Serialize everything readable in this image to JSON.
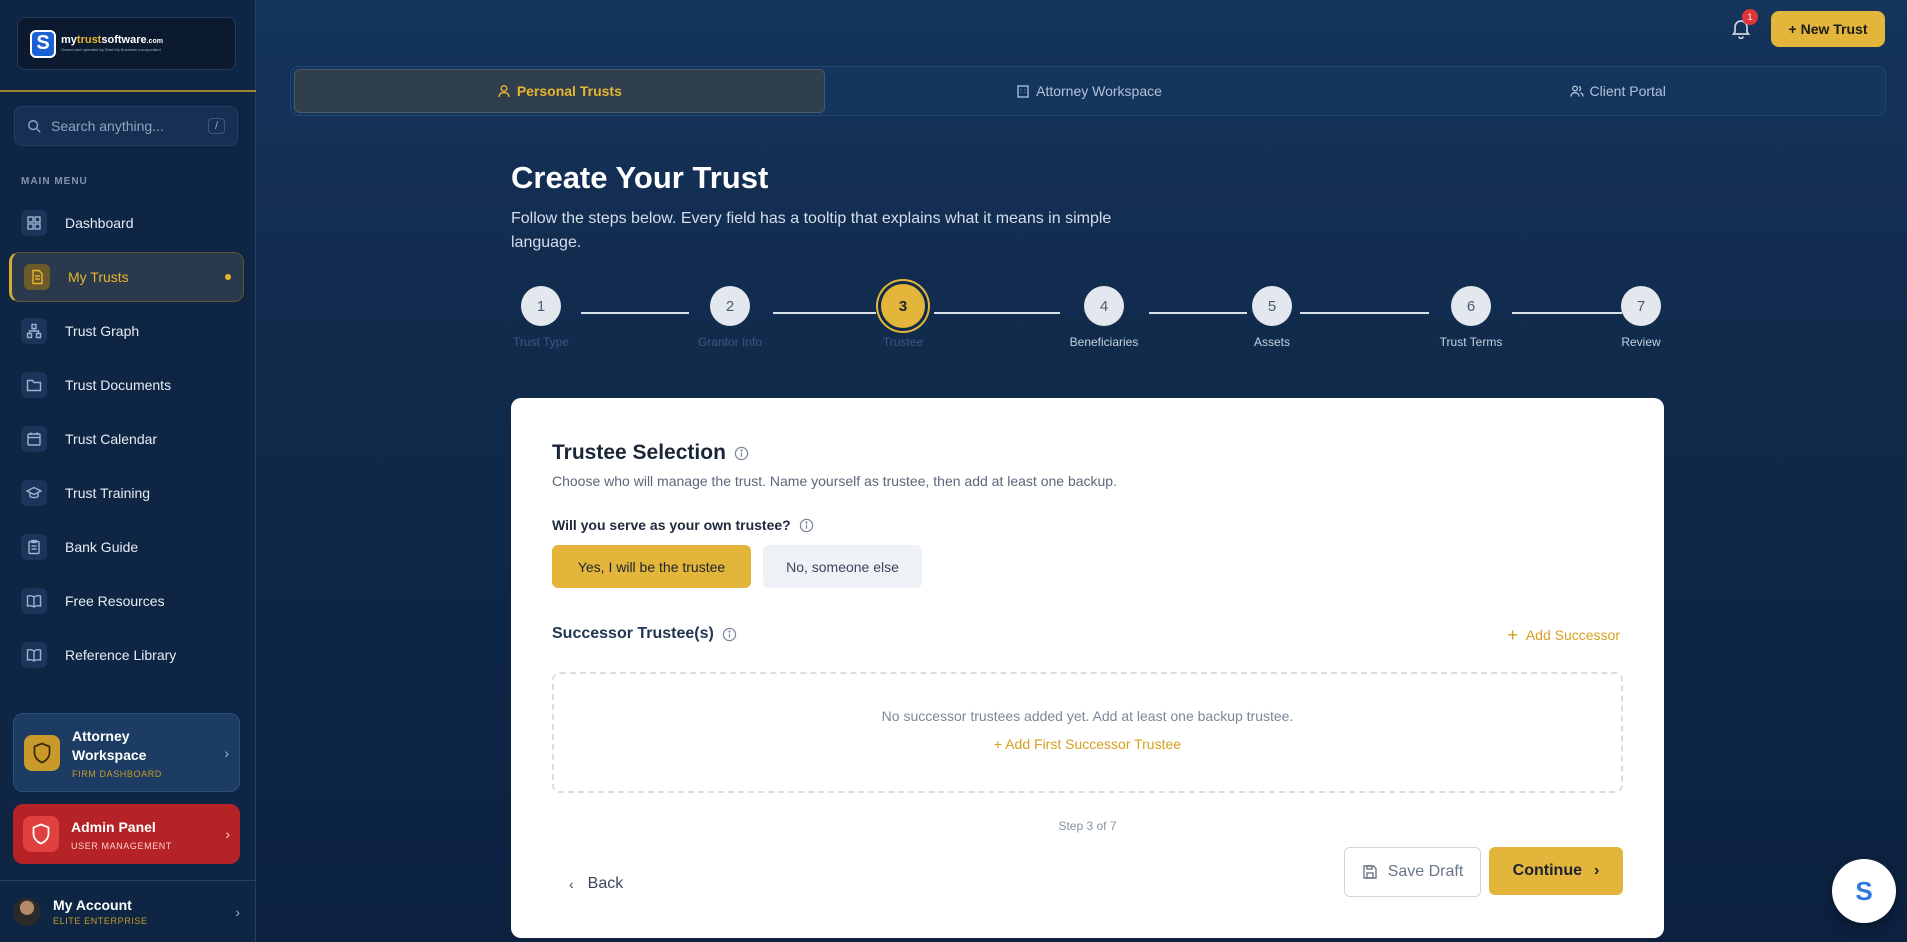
{
  "brand": {
    "logo_letter": "S",
    "name_prefix": "my",
    "name_highlight": "trust",
    "name_suffix": "software",
    "domain": ".com",
    "tagline": "Owned and operated by Start My Business Incorporated"
  },
  "search": {
    "placeholder": "Search anything...",
    "shortcut": "/"
  },
  "sidebar": {
    "section_label": "MAIN MENU",
    "items": [
      {
        "label": "Dashboard",
        "icon": "grid-icon"
      },
      {
        "label": "My Trusts",
        "icon": "document-icon",
        "active": true
      },
      {
        "label": "Trust Graph",
        "icon": "graph-icon"
      },
      {
        "label": "Trust Documents",
        "icon": "folder-icon"
      },
      {
        "label": "Trust Calendar",
        "icon": "calendar-icon"
      },
      {
        "label": "Trust Training",
        "icon": "graduation-cap-icon"
      },
      {
        "label": "Bank Guide",
        "icon": "clipboard-icon"
      },
      {
        "label": "Free Resources",
        "icon": "book-icon"
      },
      {
        "label": "Reference Library",
        "icon": "book-open-icon"
      }
    ],
    "attorney_card": {
      "title": "Attorney Workspace",
      "subtitle": "FIRM DASHBOARD"
    },
    "admin_card": {
      "title": "Admin Panel",
      "subtitle": "USER MANAGEMENT"
    },
    "account": {
      "name": "My Account",
      "plan": "ELITE ENTERPRISE"
    }
  },
  "topbar": {
    "notification_count": "1",
    "new_trust_label": "+ New Trust"
  },
  "tabs": [
    {
      "label": "Personal Trusts",
      "active": true
    },
    {
      "label": "Attorney Workspace"
    },
    {
      "label": "Client Portal"
    }
  ],
  "page": {
    "title": "Create Your Trust",
    "subtitle": "Follow the steps below. Every field has a tooltip that explains what it means in simple language."
  },
  "stepper": {
    "current": 3,
    "steps": [
      {
        "num": "1",
        "label": "Trust Type"
      },
      {
        "num": "2",
        "label": "Grantor Info"
      },
      {
        "num": "3",
        "label": "Trustee"
      },
      {
        "num": "4",
        "label": "Beneficiaries"
      },
      {
        "num": "5",
        "label": "Assets"
      },
      {
        "num": "6",
        "label": "Trust Terms"
      },
      {
        "num": "7",
        "label": "Review"
      }
    ]
  },
  "form": {
    "title": "Trustee Selection",
    "description": "Choose who will manage the trust. Name yourself as trustee, then add at least one backup.",
    "question": "Will you serve as your own trustee?",
    "yes_label": "Yes, I will be the trustee",
    "no_label": "No, someone else",
    "successor_label": "Successor Trustee(s)",
    "add_successor": "Add Successor",
    "empty_text": "No successor trustees added yet. Add at least one backup trustee.",
    "empty_link": "+ Add First Successor Trustee",
    "step_count": "Step 3 of 7",
    "back_label": "Back",
    "save_label": "Save Draft",
    "continue_label": "Continue"
  },
  "chat": {
    "letter": "S"
  },
  "colors": {
    "accent": "#e4b53b",
    "navy": "#102a4b",
    "danger": "#b52326"
  }
}
